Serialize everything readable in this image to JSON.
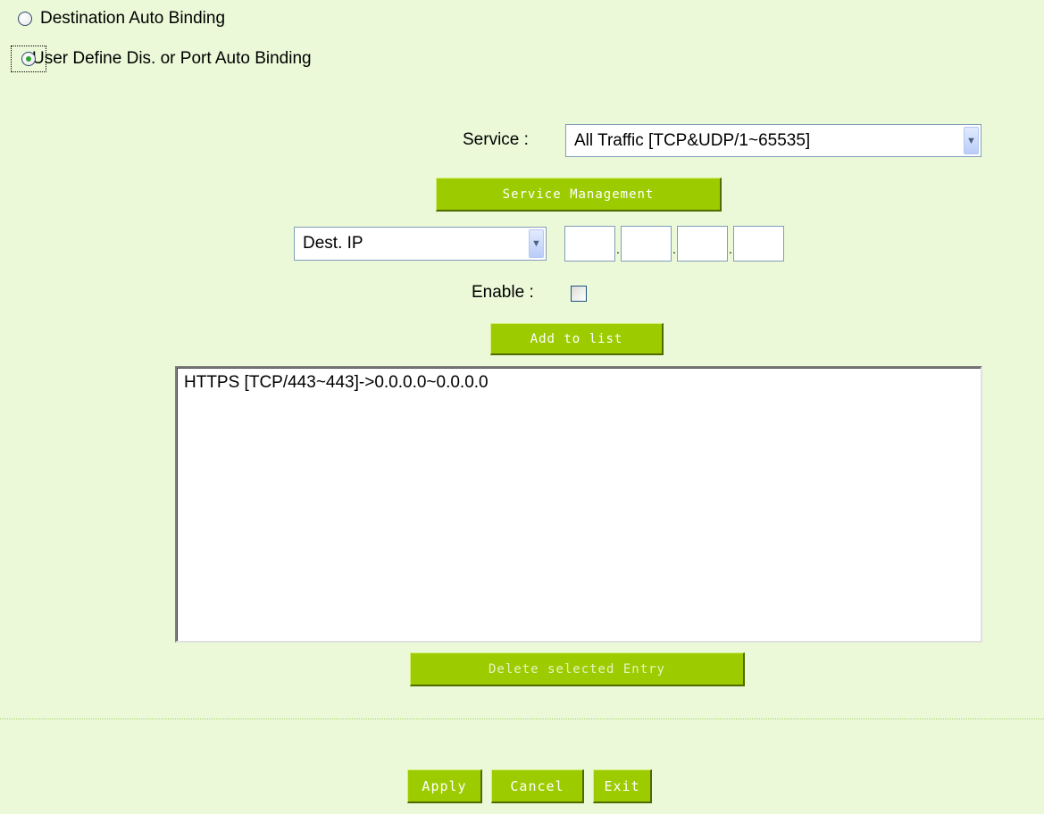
{
  "binding_mode": {
    "options": [
      {
        "label": "Destination Auto Binding",
        "checked": false
      },
      {
        "label": "User Define Dis. or Port Auto Binding",
        "checked": true
      }
    ]
  },
  "service": {
    "label": "Service :",
    "selected": "All Traffic [TCP&UDP/1~65535]"
  },
  "service_management_button": "Service Management",
  "dest": {
    "type_selected": "Dest. IP",
    "ip_octets": [
      "",
      "",
      "",
      ""
    ],
    "separator": "."
  },
  "enable": {
    "label": "Enable :",
    "checked": false
  },
  "add_to_list_button": "Add to list",
  "entries": [
    "HTTPS [TCP/443~443]->0.0.0.0~0.0.0.0"
  ],
  "delete_button": "Delete selected Entry",
  "footer": {
    "apply": "Apply",
    "cancel": "Cancel",
    "exit": "Exit"
  },
  "colors": {
    "background": "#ecf9d8",
    "button_green": "#9ccc00"
  }
}
